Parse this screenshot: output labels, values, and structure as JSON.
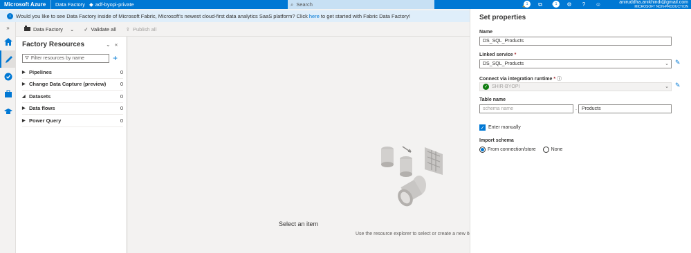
{
  "topbar": {
    "brand": "Microsoft Azure",
    "service": "Data Factory",
    "factory": "adf-byopi-private",
    "search_placeholder": "Search",
    "notifications_count": "1",
    "user_email": "aniruddha.anikhindi@gmail.com",
    "tenant": "MICROSOFT NON-PRODUCTION"
  },
  "banner": {
    "text_before": "Would you like to see Data Factory inside of Microsoft Fabric, Microsoft's newest cloud-first data analytics SaaS platform? Click",
    "link": "here",
    "text_after": "to get started with Fabric Data Factory!"
  },
  "toolbar": {
    "data_factory": "Data Factory",
    "validate_all": "Validate all",
    "publish_all": "Publish all"
  },
  "resources": {
    "title": "Factory Resources",
    "filter_placeholder": "Filter resources by name",
    "items": [
      {
        "label": "Pipelines",
        "count": "0",
        "caret": "▶"
      },
      {
        "label": "Change Data Capture (preview)",
        "count": "0",
        "caret": "▶"
      },
      {
        "label": "Datasets",
        "count": "0",
        "caret": "◢"
      },
      {
        "label": "Data flows",
        "count": "0",
        "caret": "▶"
      },
      {
        "label": "Power Query",
        "count": "0",
        "caret": "▶"
      }
    ]
  },
  "canvas": {
    "title": "Select an item",
    "subtitle": "Use the resource explorer to select or create a new ite"
  },
  "properties": {
    "title": "Set properties",
    "name_label": "Name",
    "name_value": "DS_SQL_Products",
    "linked_service_label": "Linked service",
    "linked_service_value": "DS_SQL_Products",
    "runtime_label": "Connect via integration runtime",
    "runtime_value": "SHIR-BYOPI",
    "table_label": "Table name",
    "schema_placeholder": "schema name",
    "table_value": "Products",
    "enter_manually": "Enter manually",
    "import_label": "Import schema",
    "option_connection": "From connection/store",
    "option_none": "None"
  }
}
